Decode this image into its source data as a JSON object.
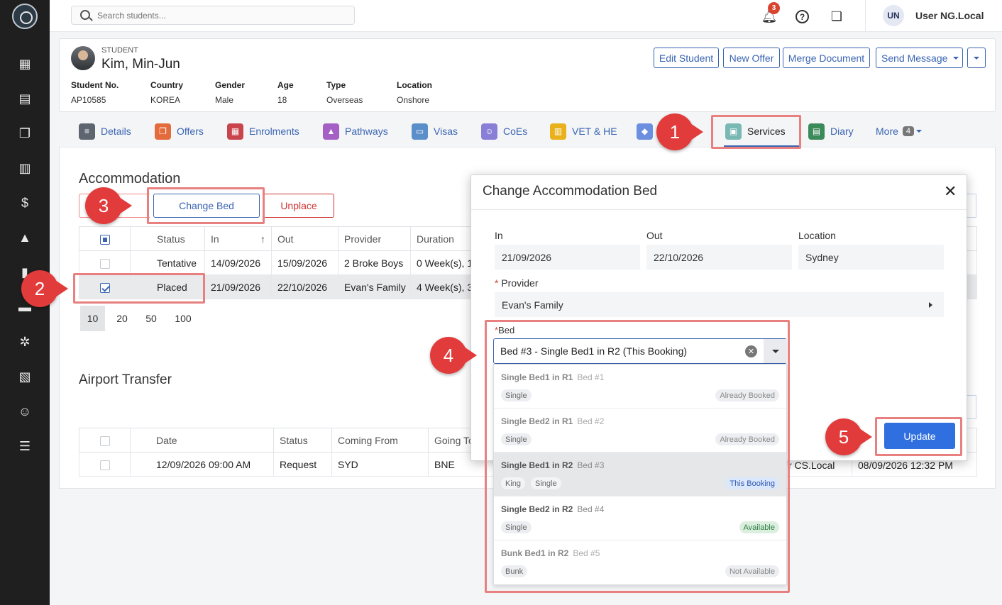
{
  "topbar": {
    "search_placeholder": "Search students...",
    "notification_count": "3",
    "avatar_initials": "UN",
    "user_name": "User NG.Local"
  },
  "student": {
    "label": "STUDENT",
    "name": "Kim, Min-Jun",
    "buttons": {
      "edit": "Edit Student",
      "offer": "New Offer",
      "merge": "Merge Document",
      "message": "Send Message"
    },
    "fields": [
      {
        "label": "Student No.",
        "value": "AP10585"
      },
      {
        "label": "Country",
        "value": "KOREA"
      },
      {
        "label": "Gender",
        "value": "Male"
      },
      {
        "label": "Age",
        "value": "18"
      },
      {
        "label": "Type",
        "value": "Overseas"
      },
      {
        "label": "Location",
        "value": "Onshore"
      }
    ]
  },
  "tabs": {
    "details": "Details",
    "offers": "Offers",
    "enrolments": "Enrolments",
    "pathways": "Pathways",
    "visas": "Visas",
    "coes": "CoEs",
    "vet": "VET & HE",
    "services": "Services",
    "diary": "Diary",
    "more": "More",
    "more_count": "4"
  },
  "accommodation": {
    "title": "Accommodation",
    "change_bed": "Change Bed",
    "unplace": "Unplace",
    "columns": [
      "Status",
      "In",
      "Out",
      "Provider",
      "Duration"
    ],
    "rows": [
      {
        "status": "Tentative",
        "in": "14/09/2026",
        "out": "15/09/2026",
        "provider": "2 Broke Boys",
        "duration": "0 Week(s), 1"
      },
      {
        "status": "Placed",
        "in": "21/09/2026",
        "out": "22/10/2026",
        "provider": "Evan's Family",
        "duration": "4 Week(s), 3"
      }
    ],
    "page_sizes": [
      "10",
      "20",
      "50",
      "100"
    ]
  },
  "airport": {
    "title": "Airport Transfer",
    "columns": [
      "Date",
      "Status",
      "Coming From",
      "Going To"
    ],
    "row": {
      "date": "12/09/2026 09:00 AM",
      "status": "Request",
      "from": "SYD",
      "to": "BNE",
      "user_tail": "r CS.Local",
      "created": "08/09/2026 12:32 PM"
    }
  },
  "modal": {
    "title": "Change Accommodation Bed",
    "in_label": "In",
    "in_value": "21/09/2026",
    "out_label": "Out",
    "out_value": "22/10/2026",
    "location_label": "Location",
    "location_value": "Sydney",
    "provider_label": "Provider",
    "provider_value": "Evan's Family",
    "bed_label": "Bed",
    "bed_value": "Bed #3 - Single Bed1 in R2 (This Booking)",
    "update": "Update",
    "options": [
      {
        "name": "Single Bed1 in R1",
        "bed": "Bed #1",
        "tags": [
          "Single"
        ],
        "status": "Already Booked"
      },
      {
        "name": "Single Bed2 in R1",
        "bed": "Bed #2",
        "tags": [
          "Single"
        ],
        "status": "Already Booked"
      },
      {
        "name": "Single Bed1 in R2",
        "bed": "Bed #3",
        "tags": [
          "King",
          "Single"
        ],
        "status": "This Booking"
      },
      {
        "name": "Single Bed2 in R2",
        "bed": "Bed #4",
        "tags": [
          "Single"
        ],
        "status": "Available"
      },
      {
        "name": "Bunk Bed1 in R2",
        "bed": "Bed #5",
        "tags": [
          "Bunk"
        ],
        "status": "Not Available"
      }
    ]
  },
  "callouts": [
    "1",
    "2",
    "3",
    "4",
    "5"
  ]
}
